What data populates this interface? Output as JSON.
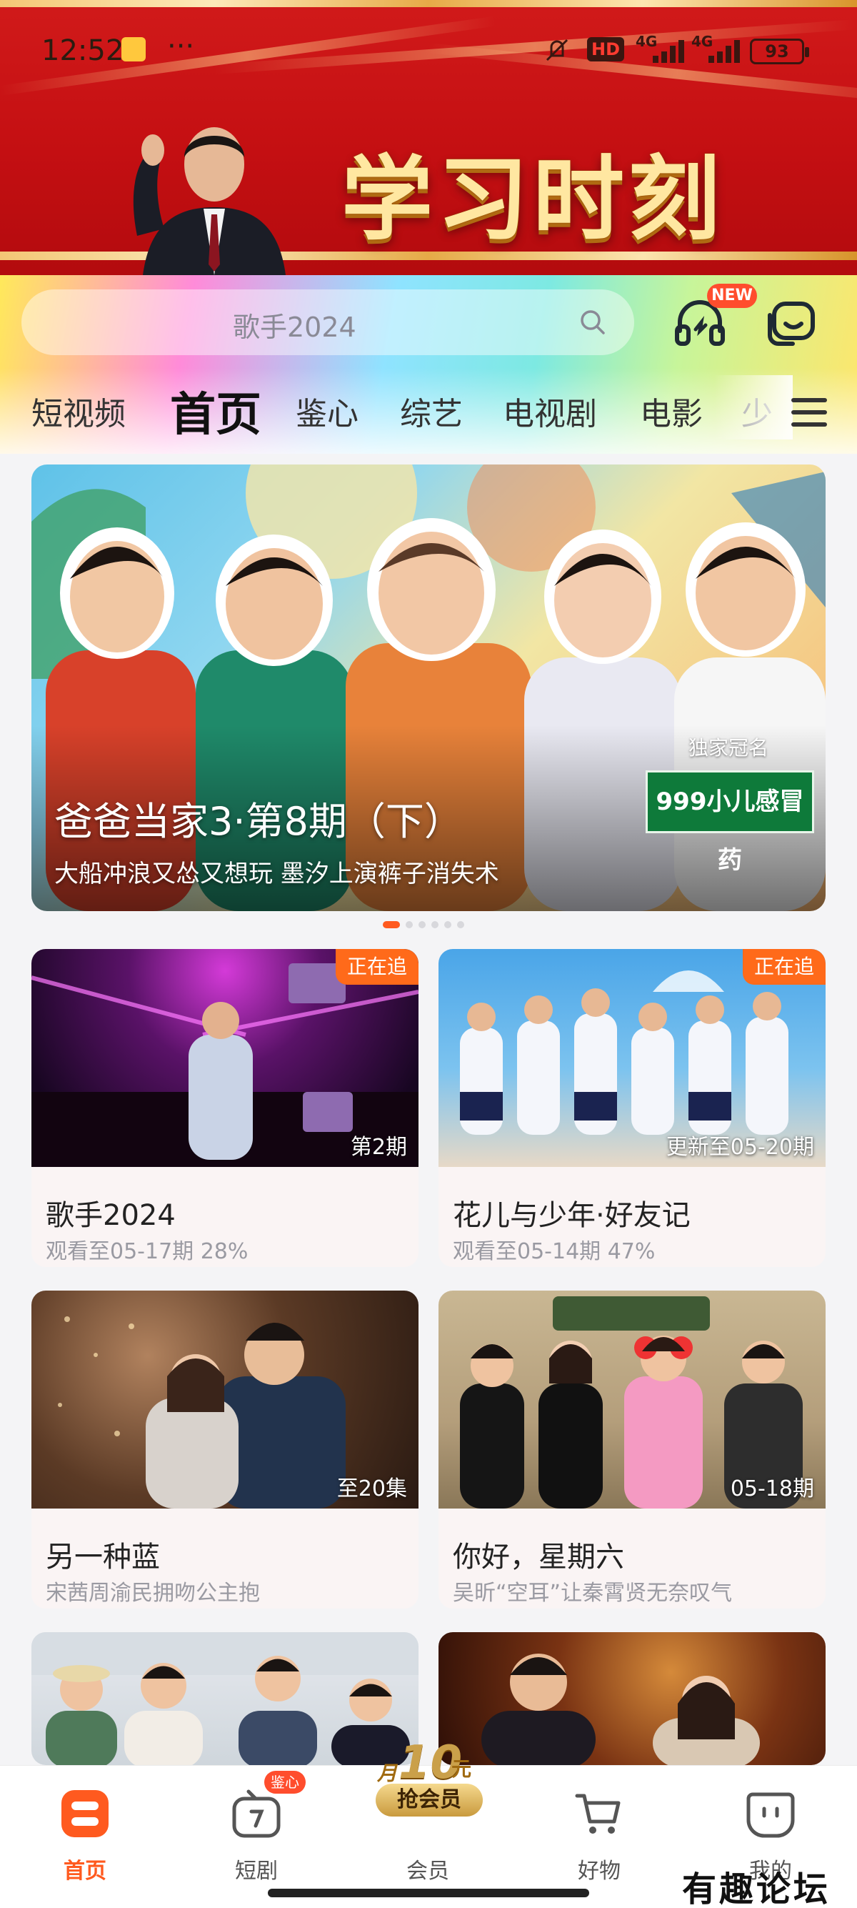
{
  "status_bar": {
    "time": "12:52",
    "more": "···",
    "hd": "HD",
    "net1": "4G",
    "net2": "4G",
    "battery": "93"
  },
  "banner": {
    "title": "学习时刻"
  },
  "search": {
    "placeholder": "歌手2024"
  },
  "header": {
    "new_badge": "NEW"
  },
  "tabs": [
    {
      "label": "短视频",
      "active": false
    },
    {
      "label": "首页",
      "active": true
    },
    {
      "label": "鉴心",
      "active": false
    },
    {
      "label": "综艺",
      "active": false
    },
    {
      "label": "电视剧",
      "active": false
    },
    {
      "label": "电影",
      "active": false
    },
    {
      "label": "少",
      "active": false
    }
  ],
  "hero": {
    "title": "爸爸当家3·第8期（下）",
    "subtitle": "大船冲浪又怂又想玩 墨汐上演裤子消失术",
    "sponsor_label": "独家冠名",
    "sponsor": "999小儿感冒药",
    "carousel_active_index": 0,
    "carousel_count": 6
  },
  "cards": [
    {
      "title": "歌手2024",
      "subtitle": "观看至05-17期 28%",
      "badge": "正在追",
      "episode": "第2期",
      "accent": "#3a0f4a"
    },
    {
      "title": "花儿与少年·好友记",
      "subtitle": "观看至05-14期 47%",
      "badge": "正在追",
      "episode": "更新至05-20期",
      "accent": "#5aa7e0"
    },
    {
      "title": "另一种蓝",
      "subtitle": "宋茜周渝民拥吻公主抱",
      "badge": "",
      "episode": "至20集",
      "accent": "#6a3b22"
    },
    {
      "title": "你好，星期六",
      "subtitle": "吴昕“空耳”让秦霄贤无奈叹气",
      "badge": "",
      "episode": "05-18期",
      "accent": "#b09b7a"
    },
    {
      "title": "",
      "subtitle": "",
      "badge": "",
      "episode": "",
      "accent": "#cfd6dc"
    },
    {
      "title": "",
      "subtitle": "",
      "badge": "",
      "episode": "",
      "accent": "#6a2a12"
    }
  ],
  "bottom_nav": {
    "items": [
      {
        "label": "首页",
        "icon": "home-icon",
        "active": true
      },
      {
        "label": "短剧",
        "icon": "tv-icon",
        "active": false
      },
      {
        "label": "会员",
        "icon": "vip-icon",
        "active": false
      },
      {
        "label": "好物",
        "icon": "cart-icon",
        "active": false
      },
      {
        "label": "我的",
        "icon": "profile-icon",
        "active": false
      }
    ],
    "jianxin_badge": "鉴心",
    "promo": {
      "prefix": "月",
      "amount": "10",
      "unit": "元",
      "label": "抢会员"
    }
  },
  "watermark": "有趣论坛",
  "colors": {
    "accent": "#ff5a1f",
    "banner_red": "#c40f12",
    "badge_orange": "#ff6a1a"
  }
}
